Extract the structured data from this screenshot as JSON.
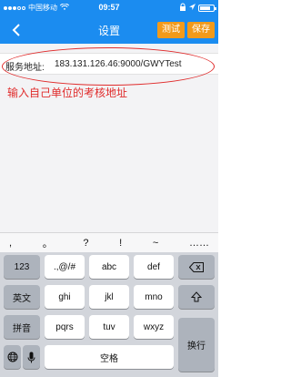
{
  "status_bar": {
    "carrier": "中国移动",
    "wifi_icon": "wifi-icon",
    "time": "09:57",
    "battery_level": 0.8,
    "battery_icon": "battery-icon"
  },
  "nav": {
    "back_icon": "‹",
    "title": "设置",
    "test_button": "测试",
    "save_button": "保存"
  },
  "form": {
    "label": "服务地址:",
    "value": "183.131.126.46:9000/GWYTest"
  },
  "annotation": {
    "text": "输入自己单位的考核地址",
    "color": "#e02c2c"
  },
  "punctuation": [
    ",",
    "。",
    "?",
    "!",
    "~",
    "……"
  ],
  "keyboard": {
    "row1": [
      "123",
      ".,@/#",
      "abc",
      "def",
      "⌫"
    ],
    "row2": [
      "英文",
      "ghi",
      "jkl",
      "mno",
      "⇧"
    ],
    "row3": [
      "拼音",
      "pqrs",
      "tuv",
      "wxyz",
      "换行"
    ],
    "row4": [
      "🌐",
      "🎤",
      "空格"
    ]
  },
  "colors": {
    "accent": "#1b8cf0",
    "button": "#f29a1a",
    "annotation": "#e02c2c"
  }
}
